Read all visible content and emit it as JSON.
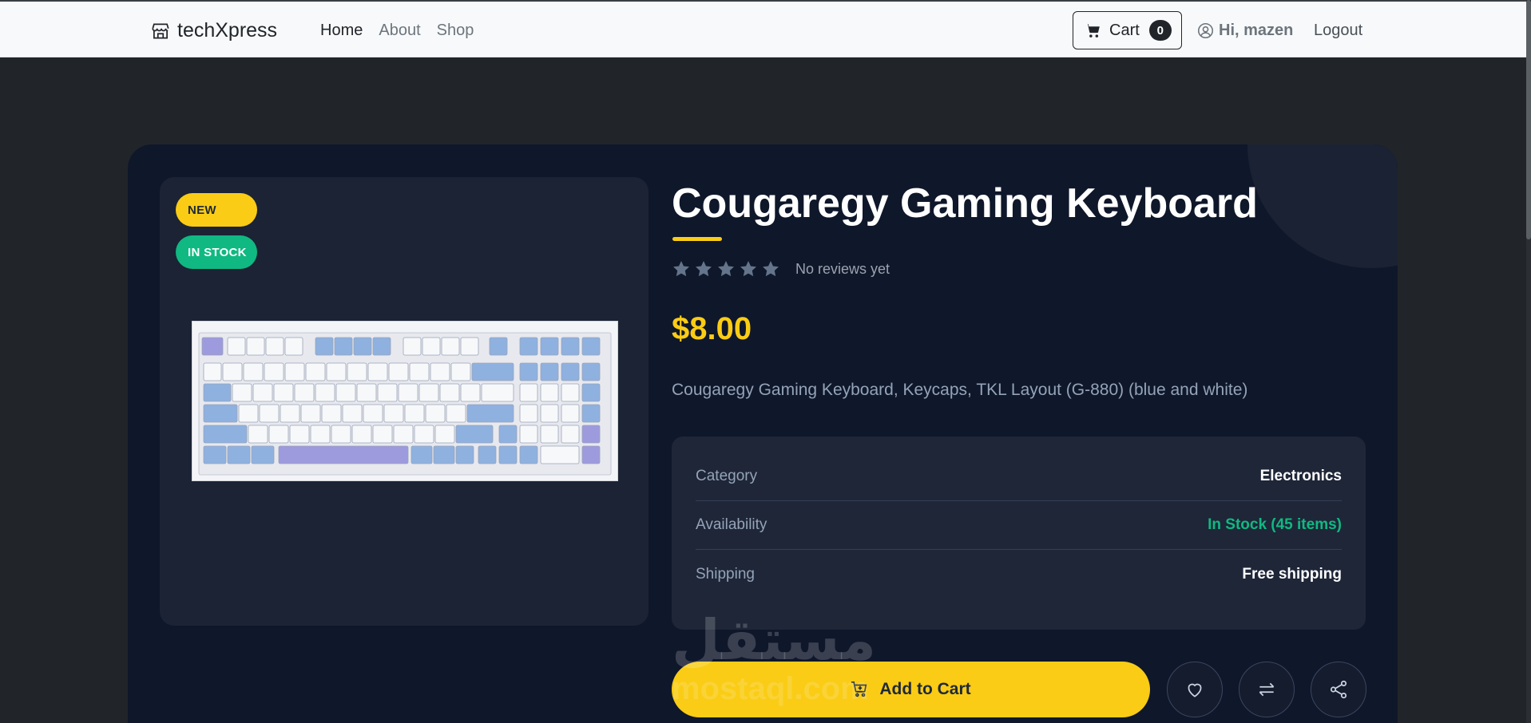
{
  "navbar": {
    "brand": "techXpress",
    "links": [
      "Home",
      "About",
      "Shop"
    ],
    "cart_label": "Cart",
    "cart_count": "0",
    "greeting": "Hi, mazen",
    "logout": "Logout"
  },
  "product": {
    "badge_new": "NEW",
    "badge_stock": "IN STOCK",
    "title": "Cougaregy Gaming Keyboard",
    "rating_stars": 5,
    "reviews_text": "No reviews yet",
    "price": "$8.00",
    "description": "Cougaregy Gaming Keyboard, Keycaps, TKL Layout (G-880) (blue and white)",
    "info": [
      {
        "label": "Category",
        "value": "Electronics"
      },
      {
        "label": "Availability",
        "value": "In Stock (45 items)"
      },
      {
        "label": "Shipping",
        "value": "Free shipping"
      }
    ],
    "add_to_cart": "Add to Cart"
  },
  "watermark": {
    "arabic": "مستقل",
    "latin": "mostaql.com"
  },
  "icons": {
    "brand": "store-icon",
    "cart": "cart-icon",
    "user": "user-circle-icon",
    "star": "star-icon",
    "wishlist": "heart-icon",
    "compare": "arrows-exchange-icon",
    "share": "share-icon"
  },
  "colors": {
    "accent": "#facc15",
    "success": "#10b981",
    "card_bg": "#0f172a",
    "page_bg": "#212529"
  }
}
